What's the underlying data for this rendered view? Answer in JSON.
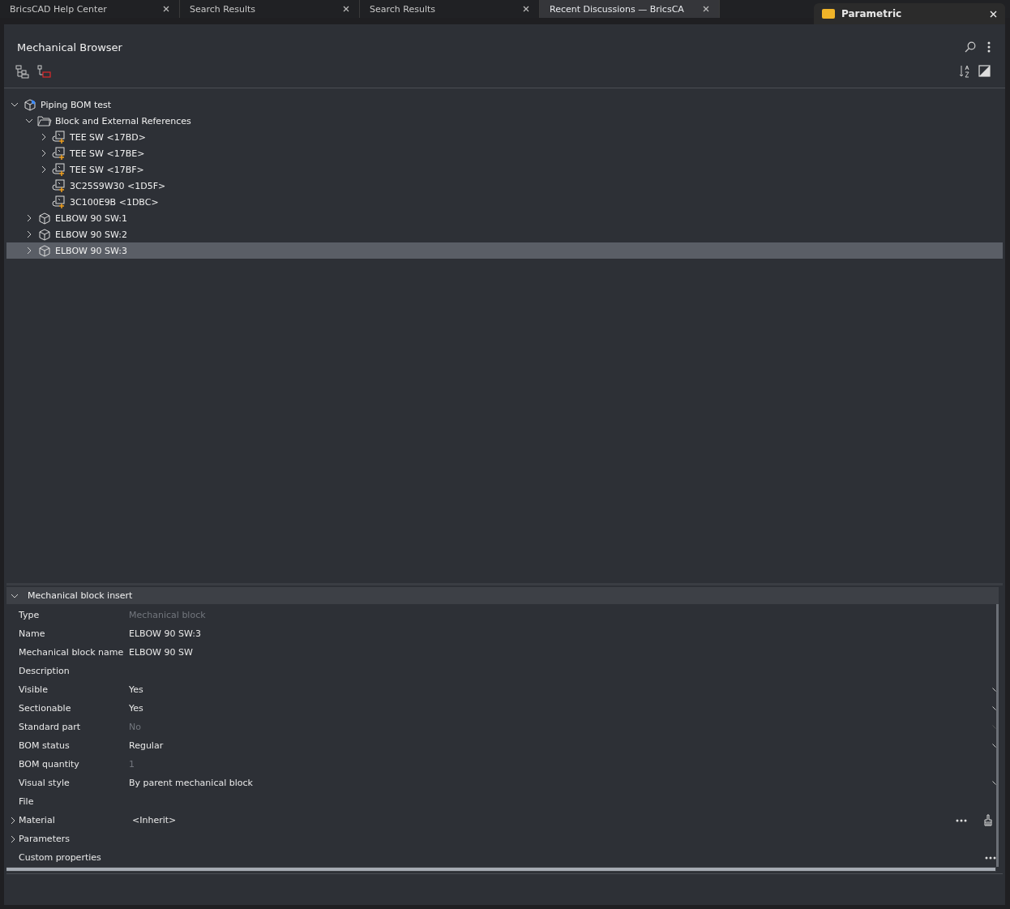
{
  "browser_tabs": [
    {
      "title": "BricsCAD Help Center",
      "selected": false
    },
    {
      "title": "Search Results",
      "selected": false
    },
    {
      "title": "Search Results",
      "selected": false
    },
    {
      "title": "Recent Discussions — BricsCA",
      "selected": true
    }
  ],
  "popup": {
    "title": "Parametric"
  },
  "panel": {
    "title": "Mechanical Browser",
    "tree": [
      {
        "label": "Piping BOM test",
        "kind": "assembly",
        "expanded": true,
        "selected": false,
        "children": [
          {
            "label": "Block and External References",
            "kind": "folder",
            "expanded": true,
            "selected": false,
            "children": [
              {
                "label": "TEE SW <17BD>",
                "kind": "block",
                "expanded": false,
                "selected": false
              },
              {
                "label": "TEE SW <17BE>",
                "kind": "block",
                "expanded": false,
                "selected": false
              },
              {
                "label": "TEE SW <17BF>",
                "kind": "block",
                "expanded": false,
                "selected": false
              },
              {
                "label": "3C25S9W30 <1D5F>",
                "kind": "block",
                "selected": false
              },
              {
                "label": "3C100E9B <1DBC>",
                "kind": "block",
                "selected": false
              }
            ]
          },
          {
            "label": "ELBOW 90 SW:1",
            "kind": "part",
            "expanded": false,
            "selected": false
          },
          {
            "label": "ELBOW 90 SW:2",
            "kind": "part",
            "expanded": false,
            "selected": false
          },
          {
            "label": "ELBOW 90 SW:3",
            "kind": "part",
            "expanded": false,
            "selected": true
          }
        ]
      }
    ],
    "properties": {
      "section": "Mechanical block insert",
      "expanded": true,
      "rows": [
        {
          "label": "Type",
          "value": "Mechanical block",
          "dimmed": true
        },
        {
          "label": "Name",
          "value": "ELBOW 90 SW:3",
          "dimmed": false
        },
        {
          "label": "Mechanical block name",
          "value": "ELBOW 90 SW",
          "dimmed": false
        },
        {
          "label": "Description"
        },
        {
          "label": "Visible",
          "value": "Yes",
          "dimmed": false,
          "dropdown": true
        },
        {
          "label": "Sectionable",
          "value": "Yes",
          "dimmed": false,
          "dropdown": true
        },
        {
          "label": "Standard part",
          "value": "No",
          "dimmed": true,
          "dropdown": true
        },
        {
          "label": "BOM status",
          "value": "Regular",
          "dimmed": false,
          "dropdown": true
        },
        {
          "label": "BOM quantity",
          "value": "1",
          "dimmed": true
        },
        {
          "label": "Visual style",
          "value": "By parent mechanical block",
          "dimmed": false,
          "dropdown": true
        },
        {
          "label": "File"
        },
        {
          "label": "Material",
          "value": "<Inherit>",
          "dimmed": false,
          "expandable": true,
          "more": true,
          "brush": true
        },
        {
          "label": "Parameters",
          "expandable": true
        },
        {
          "label": "Custom properties",
          "more": true
        }
      ]
    }
  }
}
